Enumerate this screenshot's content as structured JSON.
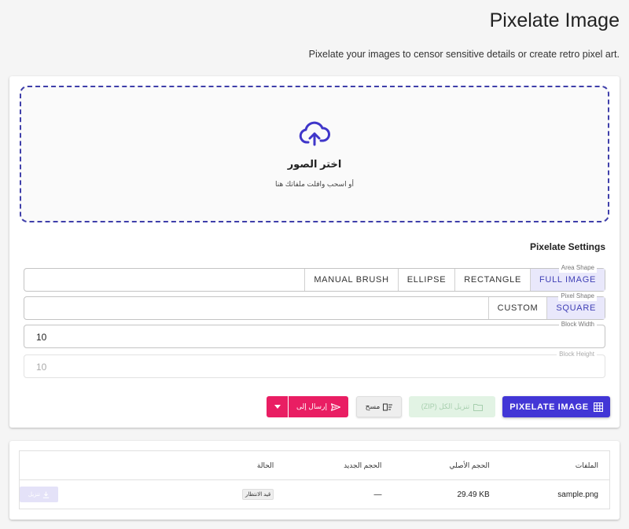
{
  "header": {
    "title": "Pixelate Image",
    "subtitle": "Pixelate your images to censor sensitive details or create retro pixel art."
  },
  "dropzone": {
    "icon": "cloud-upload-icon",
    "title": "اختر الصور",
    "subtitle": "أو اسحب وافلت ملفاتك هنا"
  },
  "settings": {
    "title": "Pixelate Settings",
    "area_shape": {
      "label": "Area Shape",
      "options": [
        "FULL IMAGE",
        "RECTANGLE",
        "ELLIPSE",
        "MANUAL BRUSH"
      ],
      "selected": "FULL IMAGE"
    },
    "pixel_shape": {
      "label": "Pixel Shape",
      "options": [
        "SQUARE",
        "CUSTOM"
      ],
      "selected": "SQUARE"
    },
    "block_width": {
      "label": "Block Width",
      "value": "10"
    },
    "block_height": {
      "label": "Block Height",
      "value": "10",
      "disabled": true
    }
  },
  "actions": {
    "pixelate_label": "PIXELATE IMAGE",
    "zip_label": "تنزيل الكل (ZIP)",
    "clear_label": "مسح",
    "send_label": "إرسال إلى",
    "colors": {
      "primary": "#4236d6",
      "send": "#e91e63",
      "zip": "#e2f3e4"
    }
  },
  "table": {
    "headers": {
      "file": "الملفات",
      "original_size": "الحجم الأصلي",
      "new_size": "الحجم الجديد",
      "status": "الحالة"
    },
    "rows": [
      {
        "file": "sample.png",
        "original_size": "29.49 KB",
        "new_size": "—",
        "status": "قيد الانتظار",
        "download_label": "تنزيل"
      }
    ]
  }
}
